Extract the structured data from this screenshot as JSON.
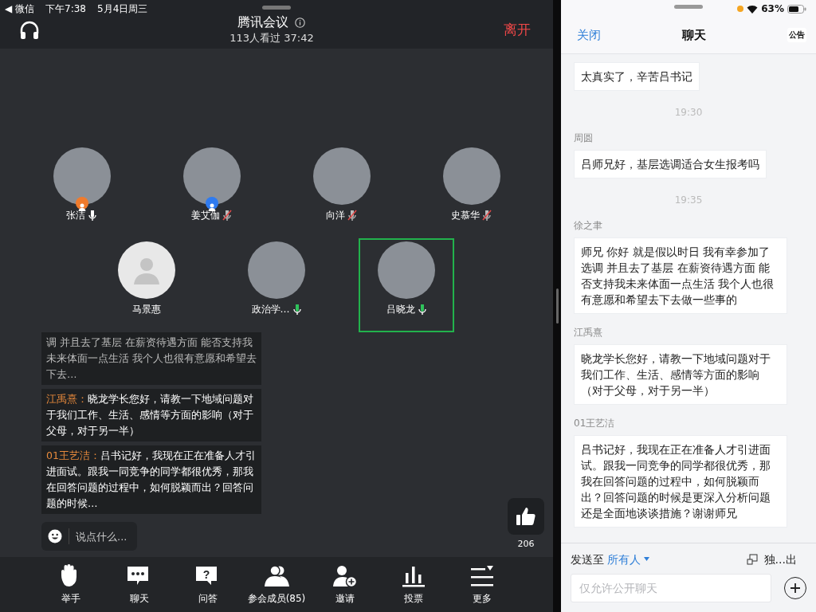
{
  "status_bar": {
    "back_app": "◀ 微信",
    "time": "下午7:38",
    "date": "5月4日周三",
    "battery_text": "63%"
  },
  "meeting_header": {
    "title": "腾讯会议",
    "subtitle": "113人看过  37:42",
    "leave": "离开"
  },
  "participants": [
    {
      "kind": "photo",
      "name": "张洁",
      "mic_icon": true,
      "muted": false,
      "speaking": false,
      "color": "#f07b2c",
      "selected": false
    },
    {
      "kind": "photo",
      "name": "姜艾伽",
      "mic_icon": true,
      "muted": true,
      "speaking": false,
      "color": "#2f7bf0",
      "selected": false
    },
    {
      "kind": "photo",
      "name": "向洋",
      "mic_icon": true,
      "muted": true,
      "speaking": false,
      "selected": false
    },
    {
      "kind": "photo",
      "name": "史慕华",
      "mic_icon": true,
      "muted": true,
      "speaking": false,
      "selected": false
    },
    {
      "kind": "default",
      "name": "马景惠",
      "mic_icon": false,
      "selected": false
    },
    {
      "kind": "photo",
      "name": "政治学…",
      "mic_icon": true,
      "muted": false,
      "speaking": true,
      "selected": false
    },
    {
      "kind": "photo",
      "name": "吕晓龙",
      "mic_icon": true,
      "muted": false,
      "speaking": true,
      "selected": true
    }
  ],
  "live_comments": [
    {
      "text": "调 并且去了基层 在薪资待遇方面 能否支持我未来体面一点生活  我个人也很有意愿和希望去下去…",
      "faded_top": true
    },
    {
      "sender": "江禹熹：",
      "text": "晓龙学长您好，请教一下地域问题对于我们工作、生活、感情等方面的影响（对于父母，对于另一半）"
    },
    {
      "sender": "01王艺洁：",
      "text": "吕书记好，我现在正在准备人才引进面试。跟我一同竞争的同学都很优秀，那我在回答问题的过程中，如何脱颖而出？回答问题的时候…"
    }
  ],
  "comment_input": {
    "placeholder": "说点什么..."
  },
  "like": {
    "count": "206"
  },
  "toolbar": [
    {
      "kind": "hand",
      "label": "举手"
    },
    {
      "kind": "chat",
      "label": "聊天"
    },
    {
      "kind": "qa",
      "glyph": "?",
      "label": "问答"
    },
    {
      "kind": "members",
      "label": "参会成员(85)"
    },
    {
      "kind": "invite",
      "label": "邀请"
    },
    {
      "kind": "poll",
      "label": "投票"
    },
    {
      "kind": "more",
      "label": "更多"
    }
  ],
  "chat_panel": {
    "close": "关闭",
    "title": "聊天",
    "notice": "公告",
    "messages": [
      {
        "kind": "message",
        "text": "太真实了，辛苦吕书记"
      },
      {
        "kind": "time",
        "text": "19:30"
      },
      {
        "kind": "message",
        "sender": "周圆",
        "text": "吕师兄好，基层选调适合女生报考吗"
      },
      {
        "kind": "time",
        "text": "19:35"
      },
      {
        "kind": "message",
        "sender": "徐之聿",
        "text": "师兄 你好 就是假以时日 我有幸参加了选调 并且去了基层 在薪资待遇方面 能否支持我未来体面一点生活  我个人也很有意愿和希望去下去做一些事的"
      },
      {
        "kind": "message",
        "sender": "江禹熹",
        "text": "晓龙学长您好，请教一下地域问题对于我们工作、生活、感情等方面的影响（对于父母，对于另一半）"
      },
      {
        "kind": "message",
        "sender": "01王艺洁",
        "text": "吕书记好，我现在正在准备人才引进面试。跟我一同竞争的同学都很优秀，那我在回答问题的过程中，如何脱颖而出？回答问题的时候是更深入分析问题还是全面地谈谈措施？谢谢师兄"
      }
    ],
    "send_to_label": "发送至",
    "send_to_value": "所有人",
    "popout": "独…出",
    "input_placeholder": "仅允许公开聊天"
  }
}
